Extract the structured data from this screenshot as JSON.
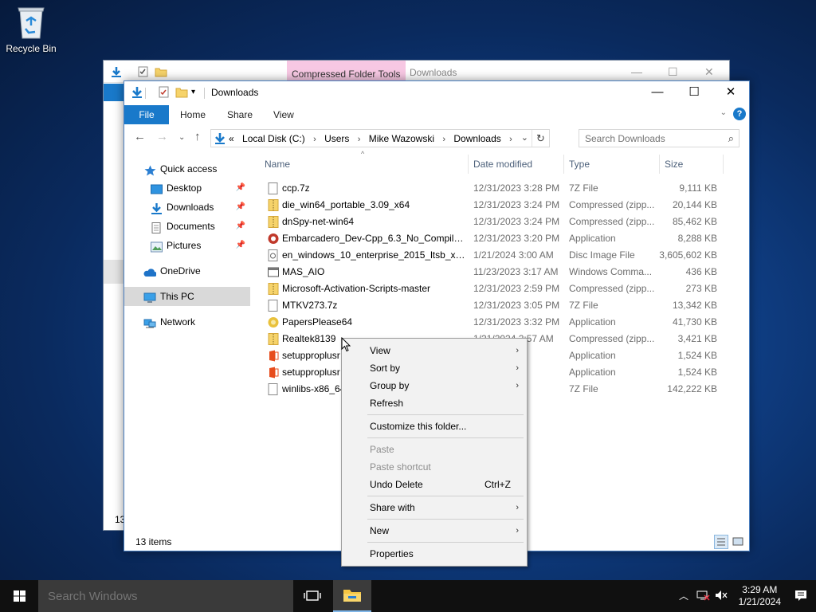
{
  "desktop": {
    "recycle_bin_label": "Recycle Bin"
  },
  "back_window": {
    "contextual_tab": "Compressed Folder Tools",
    "title": "Downloads",
    "status": "13"
  },
  "window": {
    "title": "Downloads",
    "ribbon_tabs": {
      "file": "File",
      "home": "Home",
      "share": "Share",
      "view": "View"
    },
    "address": {
      "overflow": "«",
      "parts": [
        "Local Disk (C:)",
        "Users",
        "Mike Wazowski",
        "Downloads"
      ]
    },
    "search_placeholder": "Search Downloads",
    "nav": {
      "quick_access": "Quick access",
      "desktop": "Desktop",
      "downloads": "Downloads",
      "documents": "Documents",
      "pictures": "Pictures",
      "onedrive": "OneDrive",
      "this_pc": "This PC",
      "network": "Network"
    },
    "columns": {
      "name": "Name",
      "date": "Date modified",
      "type": "Type",
      "size": "Size"
    },
    "files": [
      {
        "name": "ccp.7z",
        "date": "12/31/2023 3:28 PM",
        "type": "7Z File",
        "size": "9,111 KB"
      },
      {
        "name": "die_win64_portable_3.09_x64",
        "date": "12/31/2023 3:24 PM",
        "type": "Compressed (zipp...",
        "size": "20,144 KB"
      },
      {
        "name": "dnSpy-net-win64",
        "date": "12/31/2023 3:24 PM",
        "type": "Compressed (zipp...",
        "size": "85,462 KB"
      },
      {
        "name": "Embarcadero_Dev-Cpp_6.3_No_Compiler...",
        "date": "12/31/2023 3:20 PM",
        "type": "Application",
        "size": "8,288 KB"
      },
      {
        "name": "en_windows_10_enterprise_2015_ltsb_x64...",
        "date": "1/21/2024 3:00 AM",
        "type": "Disc Image File",
        "size": "3,605,602 KB"
      },
      {
        "name": "MAS_AIO",
        "date": "11/23/2023 3:17 AM",
        "type": "Windows Comma...",
        "size": "436 KB"
      },
      {
        "name": "Microsoft-Activation-Scripts-master",
        "date": "12/31/2023 2:59 PM",
        "type": "Compressed (zipp...",
        "size": "273 KB"
      },
      {
        "name": "MTKV273.7z",
        "date": "12/31/2023 3:05 PM",
        "type": "7Z File",
        "size": "13,342 KB"
      },
      {
        "name": "PapersPlease64",
        "date": "12/31/2023 3:32 PM",
        "type": "Application",
        "size": "41,730 KB"
      },
      {
        "name": "Realtek8139",
        "date": "1/21/2024 2:57 AM",
        "type": "Compressed (zipp...",
        "size": "3,421 KB"
      },
      {
        "name": "setupproplusr",
        "date": "...13 PM",
        "type": "Application",
        "size": "1,524 KB"
      },
      {
        "name": "setupproplusr",
        "date": "...13 PM",
        "type": "Application",
        "size": "1,524 KB"
      },
      {
        "name": "winlibs-x86_64",
        "date": "...20 PM",
        "type": "7Z File",
        "size": "142,222 KB"
      }
    ],
    "status": "13 items"
  },
  "context_menu": {
    "view": "View",
    "sort_by": "Sort by",
    "group_by": "Group by",
    "refresh": "Refresh",
    "customize": "Customize this folder...",
    "paste": "Paste",
    "paste_shortcut": "Paste shortcut",
    "undo_delete": "Undo Delete",
    "undo_shortcut": "Ctrl+Z",
    "share_with": "Share with",
    "new": "New",
    "properties": "Properties"
  },
  "taskbar": {
    "search_placeholder": "Search Windows",
    "time": "3:29 AM",
    "date": "1/21/2024"
  },
  "colors": {
    "accent": "#1979ca",
    "selection": "#d9d9d9",
    "taskbar": "#101010"
  }
}
